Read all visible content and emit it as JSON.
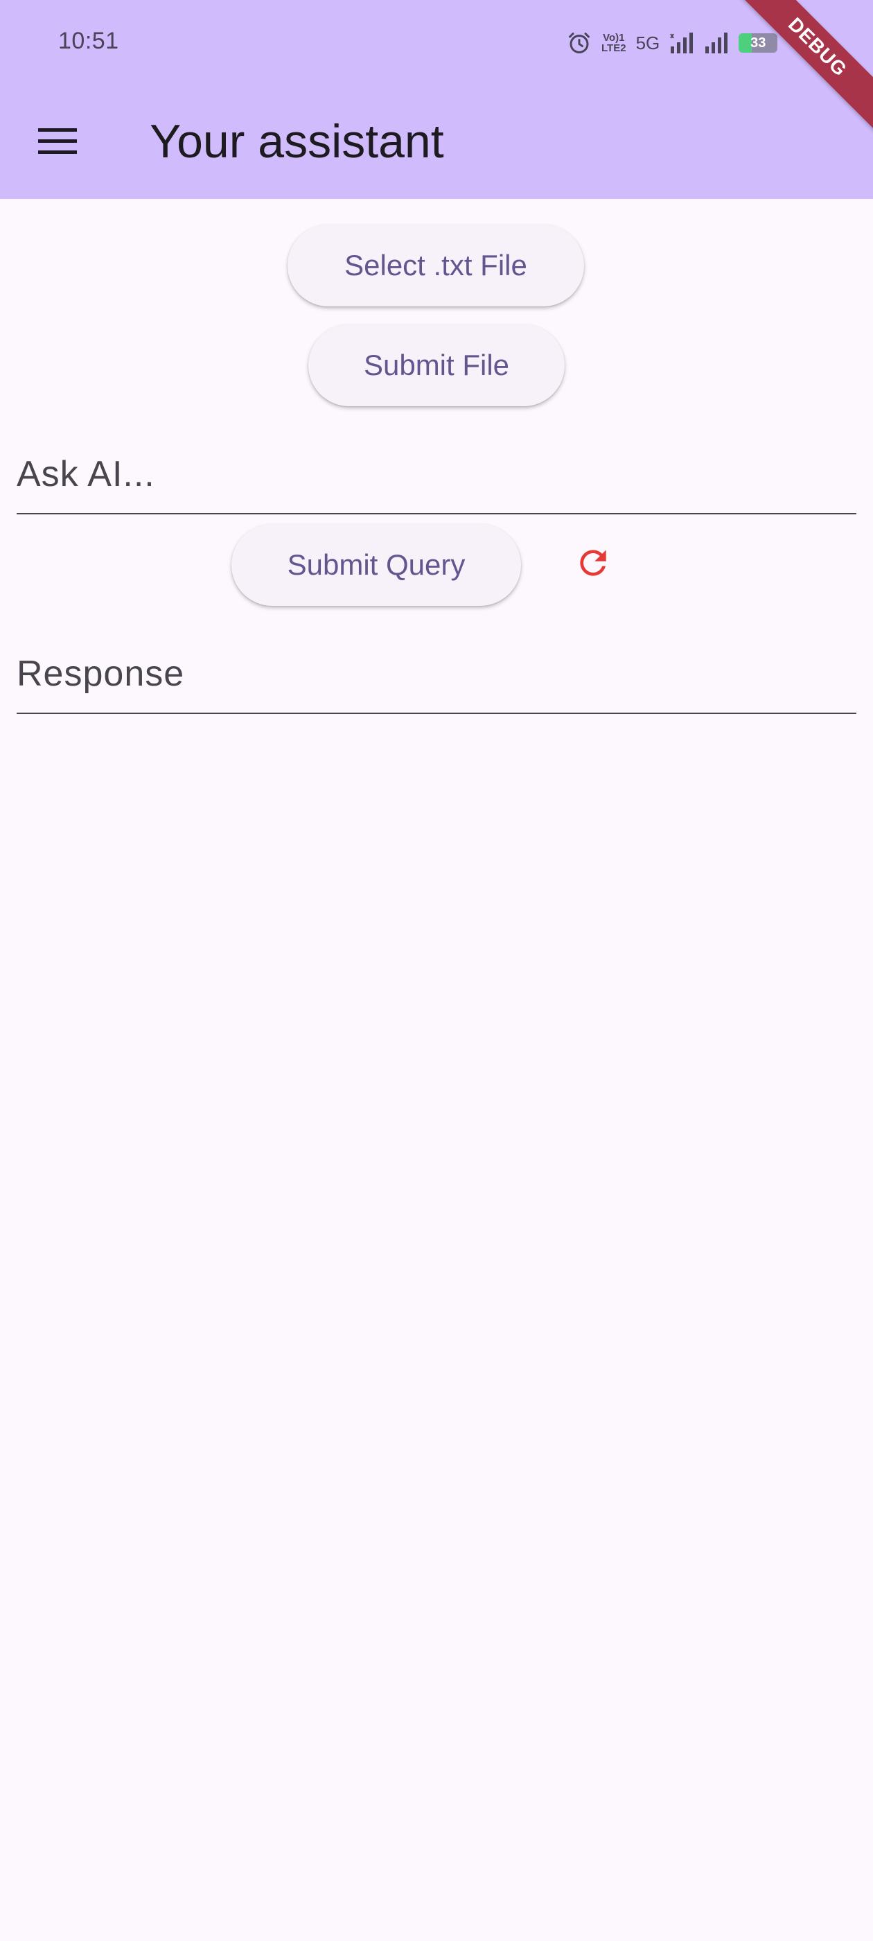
{
  "status_bar": {
    "time": "10:51",
    "volte_line1": "Vo)1",
    "volte_line2": "LTE2",
    "network": "5G",
    "battery_level": "33",
    "battery_fraction": 0.33
  },
  "debug_banner": "DEBUG",
  "app_bar": {
    "title": "Your assistant",
    "menu_icon": "hamburger-menu-icon"
  },
  "main": {
    "select_file_label": "Select .txt File",
    "submit_file_label": "Submit File",
    "query_field_label": "Ask AI...",
    "submit_query_label": "Submit Query",
    "refresh_icon": "refresh-icon",
    "response_field_label": "Response"
  },
  "colors": {
    "app_bar": "#d0bcfd",
    "background": "#fdf7fe",
    "button_text": "#65558f",
    "refresh_icon": "#e53935",
    "debug_banner": "#a8344a"
  }
}
